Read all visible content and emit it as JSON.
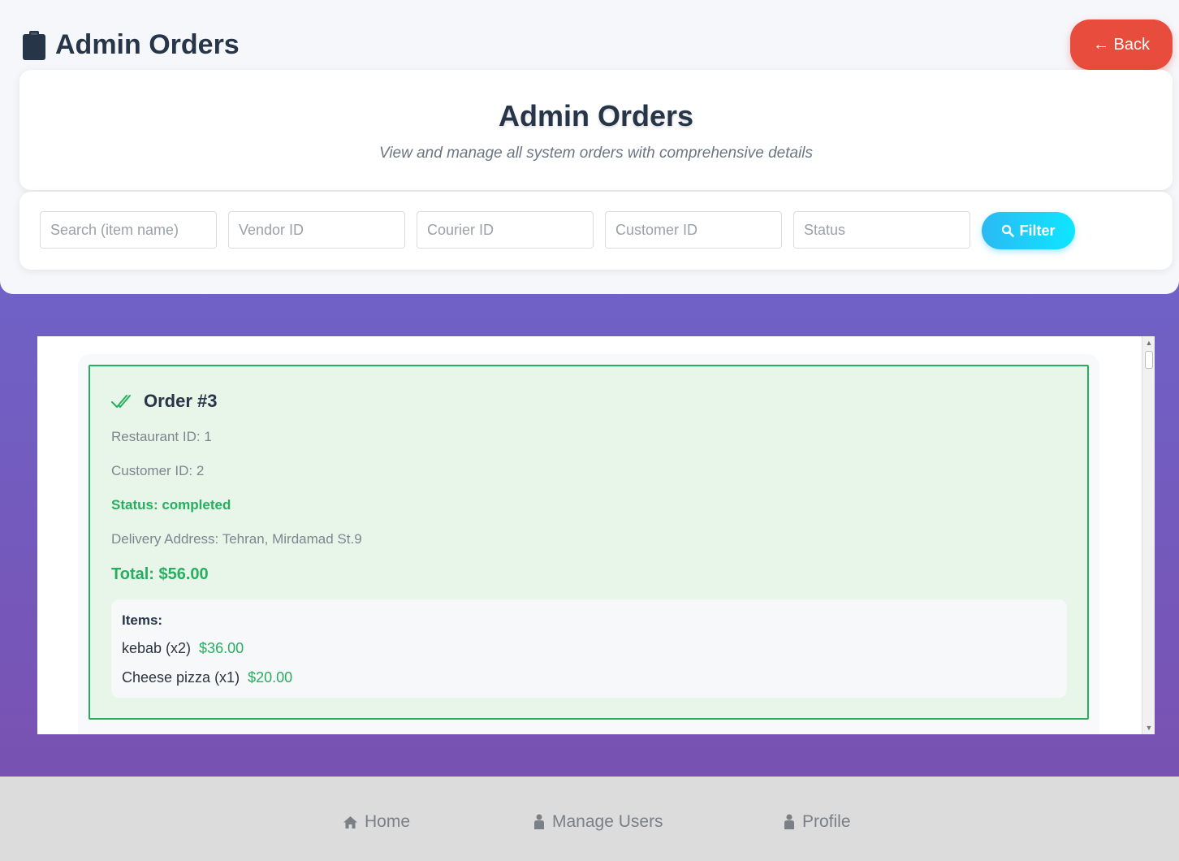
{
  "header": {
    "title": "Admin Orders",
    "back_label": "← Back"
  },
  "banner": {
    "title": "Admin Orders",
    "subtitle": "View and manage all system orders with comprehensive details"
  },
  "filters": {
    "search_placeholder": "Search (item name)",
    "vendor_placeholder": "Vendor ID",
    "courier_placeholder": "Courier ID",
    "customer_placeholder": "Customer ID",
    "status_placeholder": "Status",
    "filter_label": "Filter"
  },
  "orders": [
    {
      "title": "Order #3",
      "restaurant": "Restaurant ID: 1",
      "customer": "Customer ID: 2",
      "status": "Status: completed",
      "address": "Delivery Address: Tehran, Mirdamad St.9",
      "total": "Total: $56.00",
      "items_heading": "Items:",
      "items": [
        {
          "name": "kebab (x2)",
          "price": "$36.00"
        },
        {
          "name": "Cheese pizza (x1)",
          "price": "$20.00"
        }
      ]
    }
  ],
  "nav": {
    "home": "Home",
    "manage_users": "Manage Users",
    "profile": "Profile"
  },
  "colors": {
    "accent_red": "#e74c3c",
    "status_green": "#27ae60",
    "filter_cyan": "#0fe6ff",
    "title_dark": "#273548"
  }
}
